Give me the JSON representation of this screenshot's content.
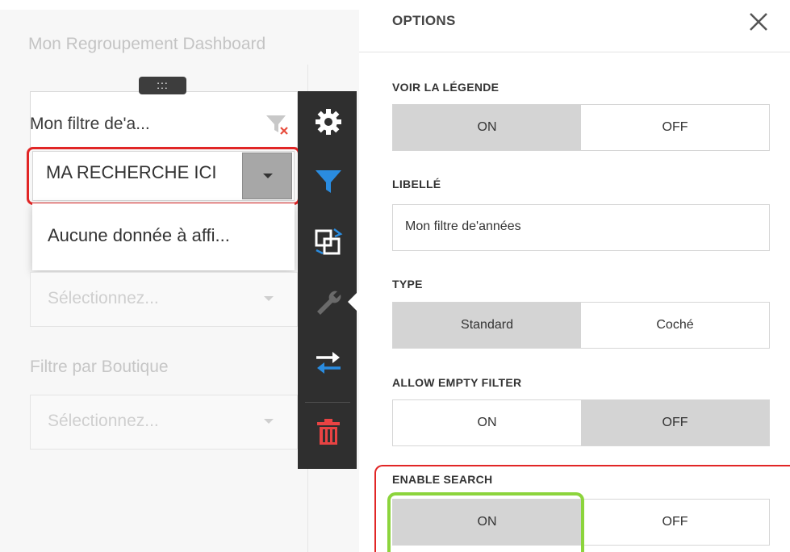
{
  "dashboard": {
    "group_title": "Mon Regroupement Dashboard",
    "drag_handle_glyph": ":::",
    "filter_title": "Mon filtre de'a...",
    "search_value": "MA RECHERCHE ICI",
    "dropdown_empty": "Aucune donnée à affi...",
    "select_placeholder_1": "Sélectionnez...",
    "filter_label_2": "Filtre par Boutique",
    "select_placeholder_2": "Sélectionnez..."
  },
  "toolbar": {
    "items": [
      {
        "icon": "gear-icon",
        "color": "#ffffff"
      },
      {
        "icon": "filter-icon",
        "color": "#2a8ce0"
      },
      {
        "icon": "convert-icon",
        "color": "#ffffff"
      },
      {
        "icon": "wrench-icon",
        "color": "#6a6a6a"
      },
      {
        "icon": "swap-arrows-icon",
        "color": "#ffffff"
      },
      {
        "icon": "trash-icon",
        "color": "#e84343"
      }
    ]
  },
  "options": {
    "title": "OPTIONS",
    "close_icon": "close-icon",
    "legend": {
      "label": "VOIR LA LÉGENDE",
      "on": "ON",
      "off": "OFF",
      "selected": "ON"
    },
    "caption": {
      "label": "LIBELLÉ",
      "value": "Mon filtre de'années"
    },
    "type": {
      "label": "TYPE",
      "standard": "Standard",
      "checked": "Coché",
      "selected": "Standard"
    },
    "allow_empty": {
      "label": "ALLOW EMPTY FILTER",
      "on": "ON",
      "off": "OFF",
      "selected": "OFF"
    },
    "enable_search": {
      "label": "ENABLE SEARCH",
      "on": "ON",
      "off": "OFF",
      "selected": "ON"
    }
  },
  "colors": {
    "highlight_red": "#e12626",
    "highlight_green": "#8cd43c",
    "toggle_active": "#d4d4d4",
    "toolbar_bg": "#2f2f2f"
  }
}
